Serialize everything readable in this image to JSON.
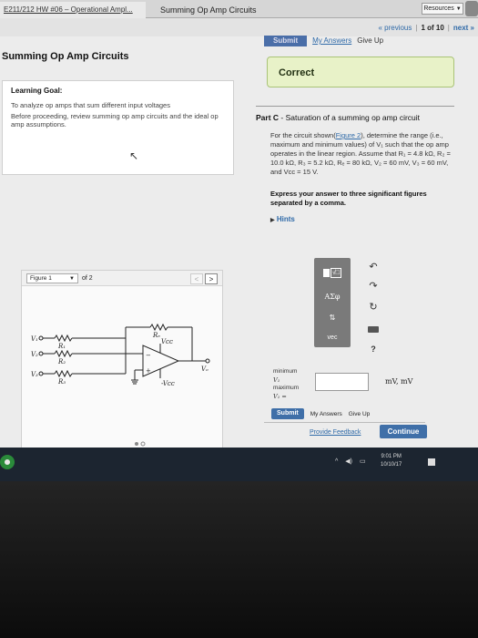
{
  "tabs": {
    "assignment": "E211/212 HW #06 – Operational Ampl...",
    "active": "Summing Op Amp Circuits",
    "resources": "Resources"
  },
  "nav": {
    "previous": "« previous",
    "page": "1 of 10",
    "next": "next »"
  },
  "top_actions": {
    "submit": "Submit",
    "my_answers": "My Answers",
    "give_up": "Give Up"
  },
  "page_title": "Summing Op Amp Circuits",
  "status": "Correct",
  "learning_goal": {
    "heading": "Learning Goal:",
    "text": "To analyze op amps that sum different input voltages",
    "note": "Before proceeding, review summing op amp circuits and the ideal op amp assumptions."
  },
  "part_c": {
    "label": "Part C",
    "title": "Saturation of a summing op amp circuit",
    "body_pre": "For the circuit shown(",
    "figure_link": "Figure 2",
    "body_post": "), determine the range (i.e., maximum and minimum values) of V₁ such that the op amp operates in the linear region. Assume that R₁ = 4.8 kΩ, R₂ = 10.0 kΩ, R₃ = 5.2 kΩ, Rₑ = 80 kΩ, V₂ = 60 mV, V₃ = 60 mV, and Vᴄᴄ = 15 V.",
    "express": "Express your answer to three significant figures separated by a comma.",
    "hints": "Hints"
  },
  "figure": {
    "select": "Figure 1",
    "of": "of 2",
    "prev": "<",
    "next": ">",
    "labels": {
      "v1": "V₁",
      "v2": "V₂",
      "v3": "V₃",
      "r1": "R₁",
      "r2": "R₂",
      "r3": "R₃",
      "rf": "Rₑ",
      "vcc_pos": "Vᴄᴄ",
      "vcc_neg": "-Vᴄᴄ",
      "vo": "Vₒ"
    }
  },
  "toolbar": {
    "templates": "√□",
    "symbols": "AΣφ",
    "arrows": "⇅",
    "vec": "vec",
    "help": "?"
  },
  "answer": {
    "min_label": "minimum",
    "min_var": "V₁",
    "max_label": "maximum",
    "max_var": "V₁ =",
    "value": "",
    "units": "mV, mV",
    "submit": "Submit",
    "my_answers": "My Answers",
    "give_up": "Give Up"
  },
  "footer": {
    "feedback": "Provide Feedback",
    "continue": "Continue"
  },
  "taskbar": {
    "time": "9:01 PM",
    "date": "10/10/17"
  }
}
